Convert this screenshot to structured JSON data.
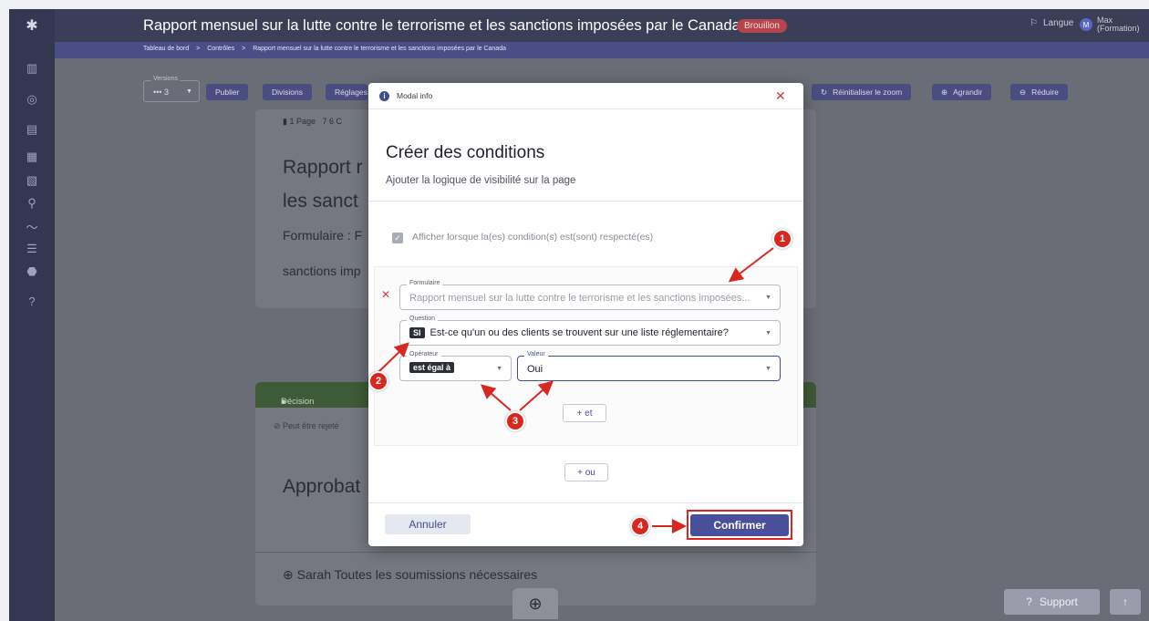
{
  "header": {
    "title": "Rapport mensuel sur la lutte contre le terrorisme et les sanctions imposées par le Canada",
    "status_badge": "Brouillon",
    "language_label": "Langue",
    "user_initial": "M",
    "user_name_line1": "Max",
    "user_name_line2": "(Formation)"
  },
  "breadcrumb": {
    "items": [
      "Tableau de bord",
      "Contrôles",
      "Rapport mensuel sur la lutte contre le terrorisme et les sanctions imposées par le Canada"
    ],
    "separator": ">"
  },
  "toolbar": {
    "versions_label": "Versions",
    "versions_value": "••• 3",
    "publish": "Publier",
    "divisions": "Divisions",
    "settings": "Réglages",
    "reset_zoom": "Réinitialiser le zoom",
    "zoom_in": "Agrandir",
    "zoom_out": "Réduire"
  },
  "background": {
    "page_meta": "1 Page",
    "page_meta_2": "7 6 C",
    "report_title_line1": "Rapport r",
    "report_title_line2": "les sanct",
    "form_line1": "Formulaire : F",
    "form_line2": "sanctions imp",
    "decision_label": "Décision",
    "rejectable": "Peut être rejeté",
    "approval": "Approbat",
    "footer_line": "Sarah  Toutes les soumissions nécessaires"
  },
  "modal": {
    "header_title": "Modal info",
    "heading": "Créer des conditions",
    "subheading": "Ajouter la logique de visibilité sur la page",
    "checkbox_label": "Afficher lorsque la(es) condition(s) est(sont) respecté(es)",
    "form_field": {
      "label": "Formulaire",
      "value": "Rapport mensuel sur la lutte contre le terrorisme et les sanctions imposées..."
    },
    "question_field": {
      "label": "Question",
      "tag": "SI",
      "value": "Est-ce qu'un ou des clients se trouvent sur une liste réglementaire?"
    },
    "operator_field": {
      "label": "Opérateur",
      "value": "est égal à"
    },
    "value_field": {
      "label": "Valeur",
      "value": "Oui"
    },
    "and_button": "+ et",
    "or_button": "+ ou",
    "cancel": "Annuler",
    "confirm": "Confirmer"
  },
  "annotations": {
    "markers": [
      "1",
      "2",
      "3",
      "4"
    ],
    "color": "#d8271f"
  },
  "bottom": {
    "support": "Support",
    "help_glyph": "?"
  },
  "colors": {
    "sidebar": "#34374f",
    "topbar": "#3b3e57",
    "primary": "#4a4f9c",
    "danger": "#d43c3c"
  }
}
